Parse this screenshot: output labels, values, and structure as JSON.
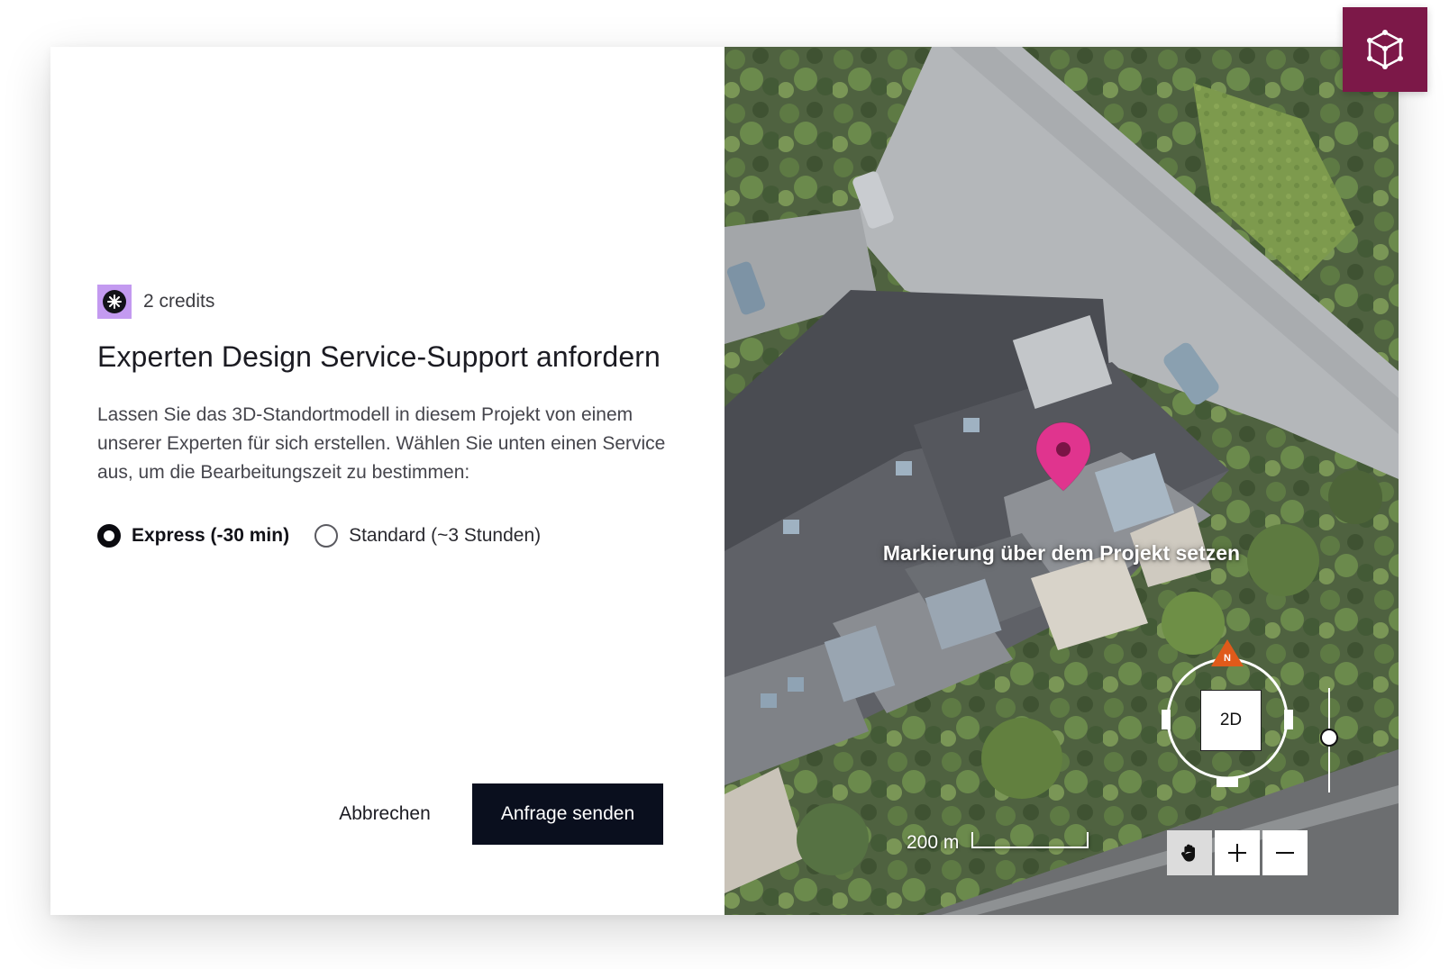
{
  "credits": {
    "label": "2 credits"
  },
  "dialog": {
    "title": "Experten Design Service-Support anfordern",
    "description": "Lassen Sie das 3D-Standortmodell in diesem Projekt von einem unserer Experten für sich erstellen. Wählen Sie unten einen Service aus, um die Bearbeitungszeit zu bestimmen:",
    "options": [
      {
        "label": "Express (-30 min)",
        "selected": true
      },
      {
        "label": "Standard (~3 Stunden)",
        "selected": false
      }
    ],
    "cancel_label": "Abbrechen",
    "submit_label": "Anfrage senden"
  },
  "map": {
    "hint": "Markierung über dem Projekt setzen",
    "compass_north": "N",
    "view_mode": "2D",
    "scale_label": "200 m",
    "tools": [
      "hand-icon",
      "zoom-in-icon",
      "zoom-out-icon"
    ],
    "active_tool": "hand-icon",
    "pin_color": "#e0348e",
    "compass_north_color": "#e05a1a"
  },
  "badge": {
    "icon": "cube-icon",
    "color": "#7c1848"
  },
  "colors": {
    "primary_button": "#0a0f1e",
    "credit_badge": "#c39af0"
  }
}
